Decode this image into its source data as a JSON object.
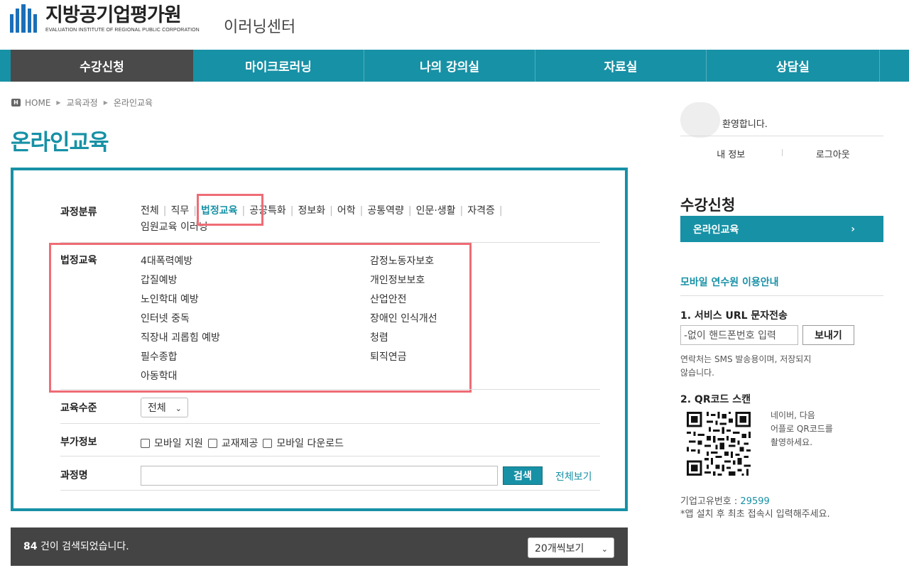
{
  "header": {
    "logo_ko": "지방공기업평가원",
    "logo_en": "EVALUATION INSTITUTE OF REGIONAL PUBLIC CORPORATION",
    "subtitle": "이러닝센터"
  },
  "nav": {
    "items": [
      {
        "label": "수강신청"
      },
      {
        "label": "마이크로러닝"
      },
      {
        "label": "나의 강의실"
      },
      {
        "label": "자료실"
      },
      {
        "label": "상담실"
      }
    ]
  },
  "breadcrumb": [
    "HOME",
    "교육과정",
    "온라인교육"
  ],
  "page_title": "온라인교육",
  "search": {
    "category_label": "과정분류",
    "categories": [
      "전체",
      "직무",
      "법정교육",
      "공공특화",
      "정보화",
      "어학",
      "공통역량",
      "인문·생활",
      "자격증",
      "임원교육 이러닝"
    ],
    "active_category": "법정교육",
    "sub_label": "법정교육",
    "sub_left": [
      "4대폭력예방",
      "갑질예방",
      "노인학대 예방",
      "인터넷 중독",
      "직장내 괴롭힘 예방",
      "필수종합",
      "아동학대"
    ],
    "sub_right": [
      "감정노동자보호",
      "개인정보보호",
      "산업안전",
      "장애인 인식개선",
      "청렴",
      "퇴직연금"
    ],
    "level_label": "교육수준",
    "level_value": "전체",
    "extra_label": "부가정보",
    "extra_options": [
      "모바일 지원",
      "교재제공",
      "모바일 다운로드"
    ],
    "course_label": "과정명",
    "course_value": "",
    "search_button": "검색",
    "view_all": "전체보기"
  },
  "results": {
    "count": "84",
    "text": "건이 검색되었습니다.",
    "page_size": "20개씩보기"
  },
  "sidebar": {
    "welcome": "환영합니다.",
    "my_info": "내 정보",
    "logout": "로그아웃",
    "heading": "수강신청",
    "menu_item": "온라인교육",
    "mobile_title": "모바일 연수원 이용안내",
    "step1": "1. 서비스 URL 문자전송",
    "phone_placeholder": "-없이 핸드폰번호 입력",
    "send_button": "보내기",
    "sms_note_1": "연락처는 SMS 발송용이며, 저장되지",
    "sms_note_2": "않습니다.",
    "step2": "2. QR코드 스캔",
    "qr_note_1": "네이버, 다음",
    "qr_note_2": "어플로 QR코드를",
    "qr_note_3": "촬영하세요.",
    "corp_label": "기업고유번호 :",
    "corp_number": "29599",
    "corp_note": "*앱 설치 후 최초 접속시 입력해주세요."
  },
  "colors": {
    "brand": "#1791a6",
    "nav_active": "#4a4a4a",
    "highlight": "#ef6c75",
    "result_bar": "#444444"
  }
}
